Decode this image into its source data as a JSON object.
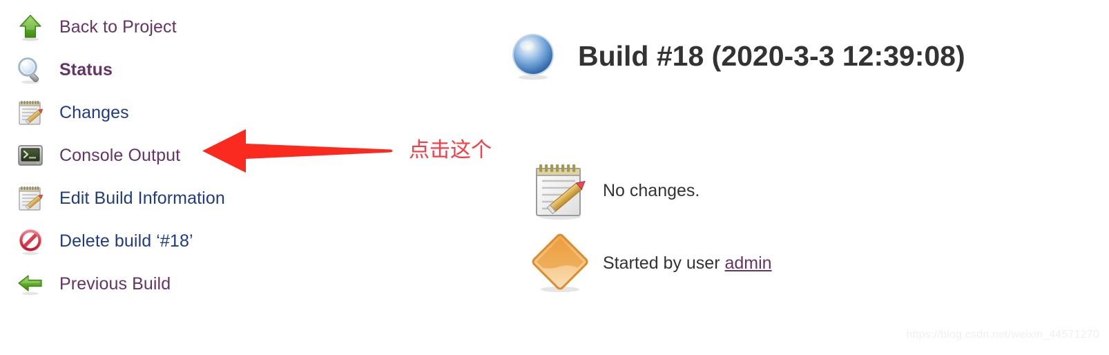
{
  "sidebar": {
    "items": [
      {
        "label": "Back to Project",
        "icon": "up-arrow-green-icon",
        "state": "visited",
        "bold": false
      },
      {
        "label": "Status",
        "icon": "magnifier-icon",
        "state": "visited",
        "bold": true
      },
      {
        "label": "Changes",
        "icon": "notepad-pencil-icon",
        "state": "new",
        "bold": false
      },
      {
        "label": "Console Output",
        "icon": "terminal-icon",
        "state": "visited",
        "bold": false
      },
      {
        "label": "Edit Build Information",
        "icon": "notepad-pencil-icon",
        "state": "new",
        "bold": false
      },
      {
        "label": "Delete build ‘#18’",
        "icon": "no-entry-icon",
        "state": "new",
        "bold": false
      },
      {
        "label": "Previous Build",
        "icon": "left-arrow-green-icon",
        "state": "visited",
        "bold": false
      }
    ]
  },
  "main": {
    "build_icon": "blue-ball-icon",
    "title": "Build #18 (2020-3-3 12:39:08)",
    "rows": [
      {
        "icon": "notepad-pencil-large-icon",
        "text": "No changes.",
        "link": null
      },
      {
        "icon": "orange-diamond-icon",
        "text": "Started by user ",
        "link": "admin"
      }
    ]
  },
  "annotation": {
    "text": "点击这个",
    "arrow_color": "#fb2a1e",
    "text_color": "#fb3b44",
    "direction": "left"
  },
  "watermark": {
    "text": "https://blog.csdn.net/weixin_44571270"
  },
  "colors": {
    "link_visited": "#663366",
    "link_new": "#1f3b87",
    "title": "#333333",
    "background": "#ffffff"
  }
}
